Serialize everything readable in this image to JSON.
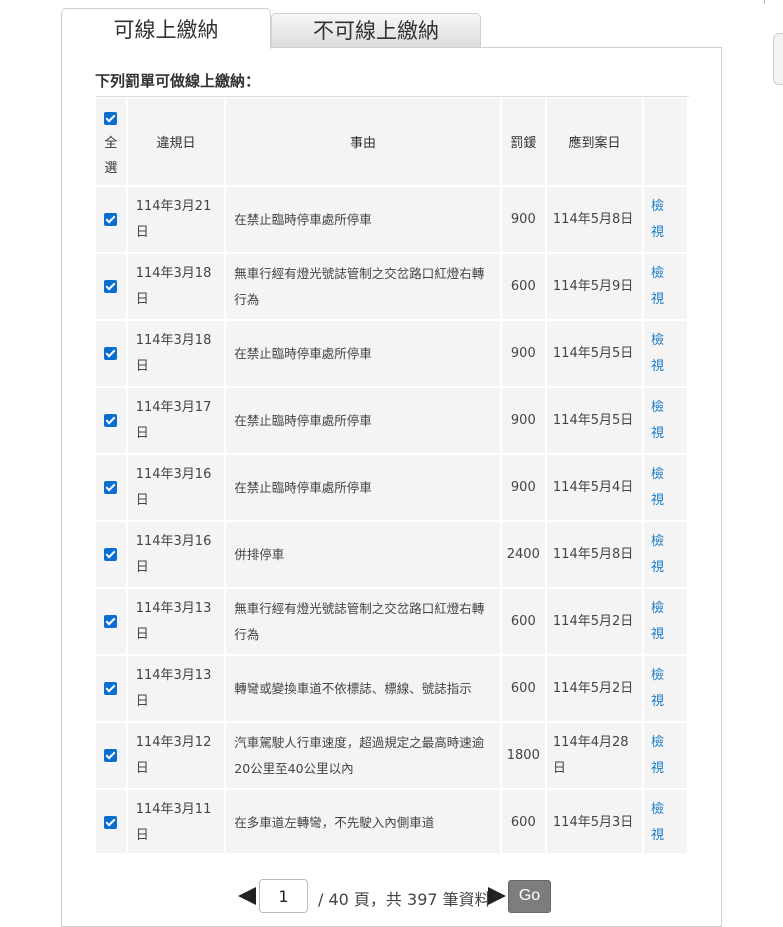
{
  "tabs": {
    "online": "可線上繳納",
    "offline": "不可線上繳納"
  },
  "heading": "下列罰單可做線上繳納：",
  "table": {
    "headers": {
      "select_all": "全選",
      "date": "違規日",
      "reason": "事由",
      "fine": "罰鍰",
      "due": "應到案日"
    },
    "view_label": "檢視",
    "rows": [
      {
        "date": "114年3月21日",
        "reason": "在禁止臨時停車處所停車",
        "fine": "900",
        "due": "114年5月8日"
      },
      {
        "date": "114年3月18日",
        "reason": "無車行經有燈光號誌管制之交岔路口紅燈右轉行為",
        "fine": "600",
        "due": "114年5月9日"
      },
      {
        "date": "114年3月18日",
        "reason": "在禁止臨時停車處所停車",
        "fine": "900",
        "due": "114年5月5日"
      },
      {
        "date": "114年3月17日",
        "reason": "在禁止臨時停車處所停車",
        "fine": "900",
        "due": "114年5月5日"
      },
      {
        "date": "114年3月16日",
        "reason": "在禁止臨時停車處所停車",
        "fine": "900",
        "due": "114年5月4日"
      },
      {
        "date": "114年3月16日",
        "reason": "併排停車",
        "fine": "2400",
        "due": "114年5月8日"
      },
      {
        "date": "114年3月13日",
        "reason": "無車行經有燈光號誌管制之交岔路口紅燈右轉行為",
        "fine": "600",
        "due": "114年5月2日"
      },
      {
        "date": "114年3月13日",
        "reason": "轉彎或變換車道不依標誌、標線、號誌指示",
        "fine": "600",
        "due": "114年5月2日"
      },
      {
        "date": "114年3月12日",
        "reason": "汽車駕駛人行車速度，超過規定之最高時速逾20公里至40公里以內",
        "fine": "1800",
        "due": "114年4月28日"
      },
      {
        "date": "114年3月11日",
        "reason": "在多車道左轉彎，不先駛入內側車道",
        "fine": "600",
        "due": "114年5月3日"
      }
    ]
  },
  "pager": {
    "current_page": "1",
    "summary": "/ 40 頁，共 397 筆資料",
    "go_label": "Go"
  },
  "icons": {
    "checkbox": "checkbox-checked-icon",
    "prev": "triangle-left-icon",
    "next": "triangle-right-icon"
  },
  "colors": {
    "checkbox": "#0a6ed1",
    "link": "#1a7dc6",
    "go_button": "#7d7d7d"
  }
}
